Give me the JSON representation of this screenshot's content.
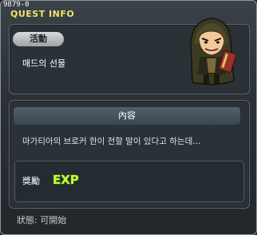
{
  "window": {
    "quest_id": "9879-0",
    "title": "QUEST INFO"
  },
  "quest": {
    "activity_label": "活動",
    "name": "매드의 선물",
    "npc_icon": "hooded-npc-portrait"
  },
  "content": {
    "header": "內容",
    "description": "마가티아의 브로커 한이 전할 말이 있다고 하는데..."
  },
  "reward": {
    "label": "獎勵",
    "icon": "exp-icon",
    "icon_text": "EXP"
  },
  "status": {
    "text": "狀態:  可開始"
  },
  "colors": {
    "title": "#f1e36a",
    "exp_fill": "#d8f23a",
    "exp_outline": "#1f6b1a"
  }
}
